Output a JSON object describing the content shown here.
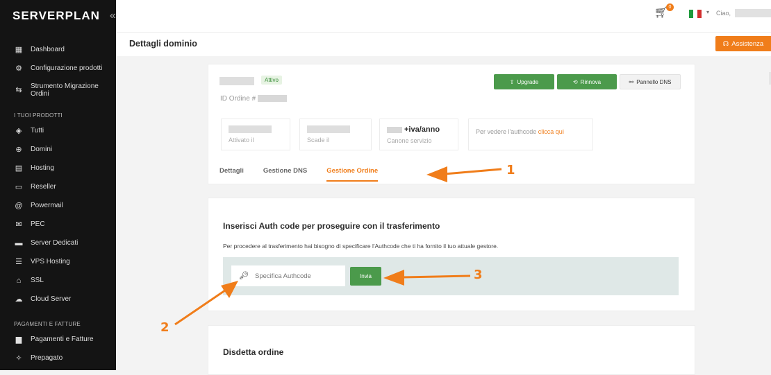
{
  "brand": {
    "name_a": "SERVER",
    "name_b": "PLAN",
    "collapse": "«"
  },
  "sidebar": {
    "items_top": [
      {
        "label": "Dashboard",
        "icon": "dashboard-icon",
        "glyph": "▦"
      },
      {
        "label": "Configurazione prodotti",
        "icon": "config-icon",
        "glyph": "⚙"
      },
      {
        "label": "Strumento Migrazione Ordini",
        "icon": "migrate-icon",
        "glyph": "⇆"
      }
    ],
    "section_products": "I TUOI PRODOTTI",
    "items_products": [
      {
        "label": "Tutti",
        "icon": "all-icon",
        "glyph": "◈"
      },
      {
        "label": "Domini",
        "icon": "globe-icon",
        "glyph": "⊕"
      },
      {
        "label": "Hosting",
        "icon": "hosting-icon",
        "glyph": "▤"
      },
      {
        "label": "Reseller",
        "icon": "reseller-icon",
        "glyph": "▭"
      },
      {
        "label": "Powermail",
        "icon": "at-icon",
        "glyph": "@"
      },
      {
        "label": "PEC",
        "icon": "mail-icon",
        "glyph": "✉"
      },
      {
        "label": "Server Dedicati",
        "icon": "server-icon",
        "glyph": "▬"
      },
      {
        "label": "VPS Hosting",
        "icon": "vps-icon",
        "glyph": "☰"
      },
      {
        "label": "SSL",
        "icon": "lock-icon",
        "glyph": "⌂"
      },
      {
        "label": "Cloud Server",
        "icon": "cloud-icon",
        "glyph": "☁"
      }
    ],
    "section_payments": "PAGAMENTI E FATTURE",
    "items_payments": [
      {
        "label": "Pagamenti e Fatture",
        "icon": "folder-icon",
        "glyph": "▆"
      },
      {
        "label": "Prepagato",
        "icon": "prepaid-icon",
        "glyph": "✧"
      }
    ]
  },
  "topbar": {
    "cart_count": "0",
    "greeting": "Ciao,"
  },
  "page": {
    "title": "Dettagli dominio",
    "assist_label": "Assistenza",
    "assist_glyph": "☊"
  },
  "domain": {
    "status": "Attivo",
    "order_id_label": "ID Ordine #",
    "buttons": {
      "upgrade": "Upgrade",
      "rinnova": "Rinnova",
      "dns": "Pannello DNS"
    },
    "button_glyphs": {
      "upgrade": "⇧",
      "rinnova": "⟲",
      "dns": "⚯"
    },
    "stats": {
      "activated_label": "Attivato il",
      "expires_label": "Scade il",
      "fee_value": "+iva/anno",
      "fee_label": "Canone servizio",
      "authcode_note": "Per vedere l'authcode",
      "authcode_link": "clicca qui"
    },
    "tabs": [
      "Dettagli",
      "Gestione DNS",
      "Gestione Ordine"
    ]
  },
  "auth": {
    "title": "Inserisci Auth code per proseguire con il trasferimento",
    "description": "Per procedere al trasferimento hai bisogno di specificare l'Authcode che ti ha fornito il tuo attuale gestore.",
    "placeholder": "Specifica Authcode",
    "submit": "Invia"
  },
  "cancel": {
    "title": "Disdetta ordine"
  },
  "annotations": [
    "1",
    "2",
    "3"
  ],
  "colors": {
    "accent": "#f07d1a",
    "green": "#4b9a4b",
    "sidebar": "#141414"
  }
}
